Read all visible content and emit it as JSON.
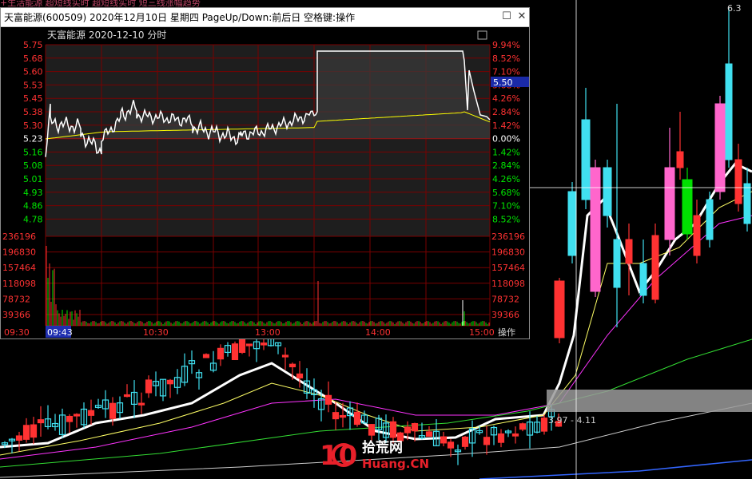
{
  "window": {
    "title": "天富能源(600509) 2020年12月10日 星期四 PageUp/Down:前后日 空格键:操作",
    "maximize_icon": "maximize-icon",
    "close_icon": "close-icon"
  },
  "intraday": {
    "header": "天富能源   2020-12-10 分时",
    "price_ticks": [
      "5.75",
      "5.68",
      "5.60",
      "5.53",
      "5.45",
      "5.38",
      "5.30",
      "5.23",
      "5.16",
      "5.08",
      "5.01",
      "4.93",
      "4.86",
      "4.78"
    ],
    "pct_ticks": [
      "9.94%",
      "8.52%",
      "7.10%",
      "5.68%",
      "4.26%",
      "2.84%",
      "1.42%",
      "0.00%",
      "1.42%",
      "2.84%",
      "4.26%",
      "5.68%",
      "7.10%",
      "8.52%"
    ],
    "current_price": "5.50",
    "volume_ticks": [
      "236196",
      "196830",
      "157464",
      "118098",
      "78732",
      "39366"
    ],
    "time_labels": [
      "09:30",
      "10:30",
      "13:00",
      "14:00",
      "15:00"
    ],
    "cursor_time": "09:43",
    "op_button": "操作",
    "colors": {
      "up": "#ff3232",
      "down": "#00e600",
      "price_line": "#ffffff",
      "avg_line": "#ffff00",
      "grid": "#7a0000"
    }
  },
  "background_chart": {
    "top_right_price": "6.3",
    "range_label": "3.97 - 4.11",
    "obscured_title": "+生活能源 超短线实时 超短线实时 短三线涨幅趋势"
  },
  "watermark": {
    "logo_text": "10",
    "cn_text": "拾荒网",
    "en_text": "Huang.CN"
  }
}
